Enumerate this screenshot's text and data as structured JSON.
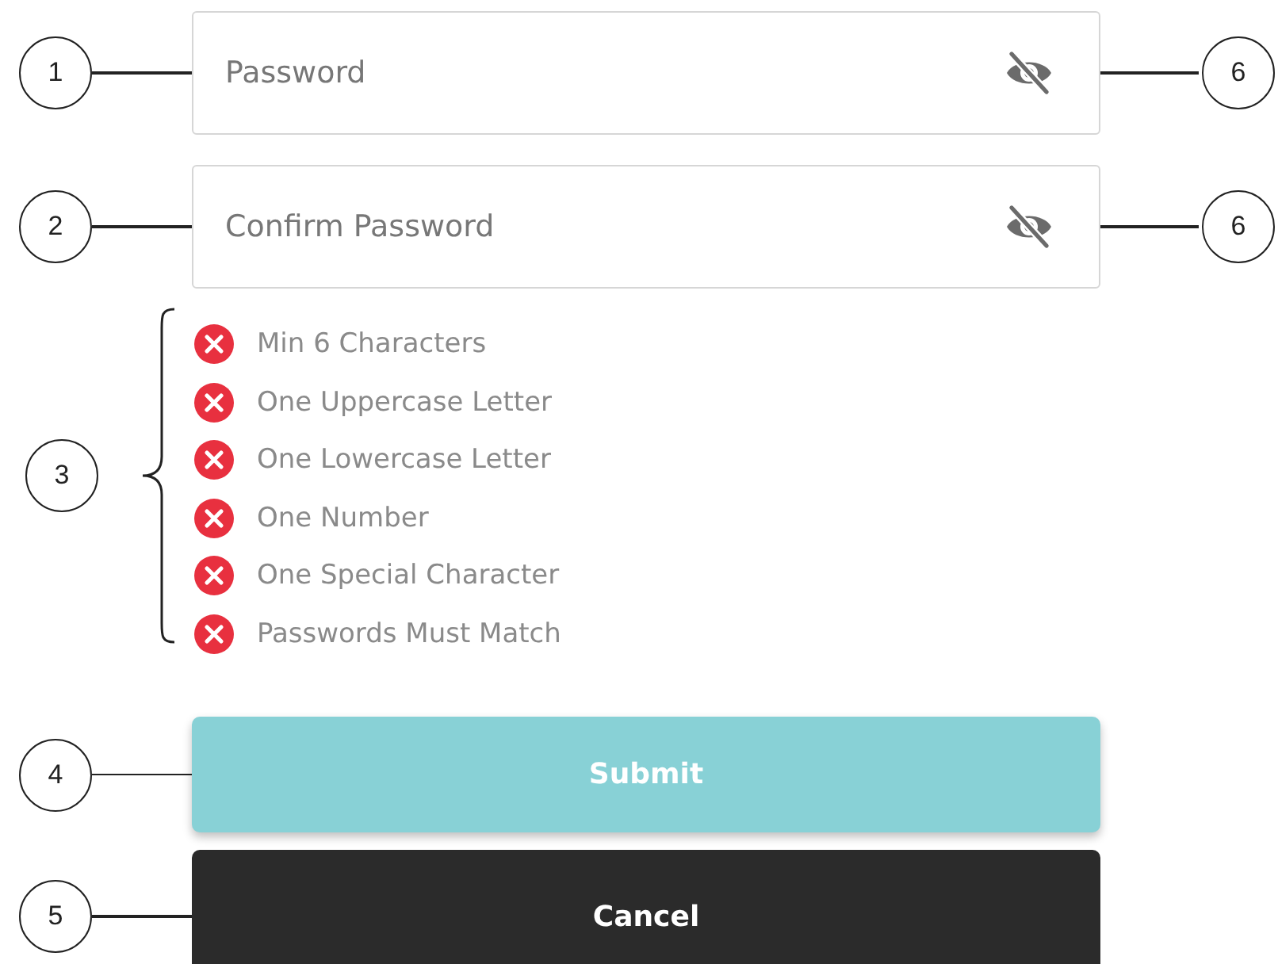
{
  "fields": [
    {
      "placeholder": "Password",
      "callout": "1",
      "toggle_callout": "6"
    },
    {
      "placeholder": "Confirm Password",
      "callout": "2",
      "toggle_callout": "6"
    }
  ],
  "rules": {
    "callout": "3",
    "items": [
      {
        "label": "Min 6 Characters",
        "met": false
      },
      {
        "label": "One Uppercase Letter",
        "met": false
      },
      {
        "label": "One Lowercase Letter",
        "met": false
      },
      {
        "label": "One Number",
        "met": false
      },
      {
        "label": "One Special Character",
        "met": false
      },
      {
        "label": "Passwords Must Match",
        "met": false
      }
    ]
  },
  "buttons": [
    {
      "label": "Submit",
      "kind": "primary",
      "disabled": true,
      "callout": "4"
    },
    {
      "label": "Cancel",
      "kind": "secondary",
      "callout": "5"
    }
  ]
}
